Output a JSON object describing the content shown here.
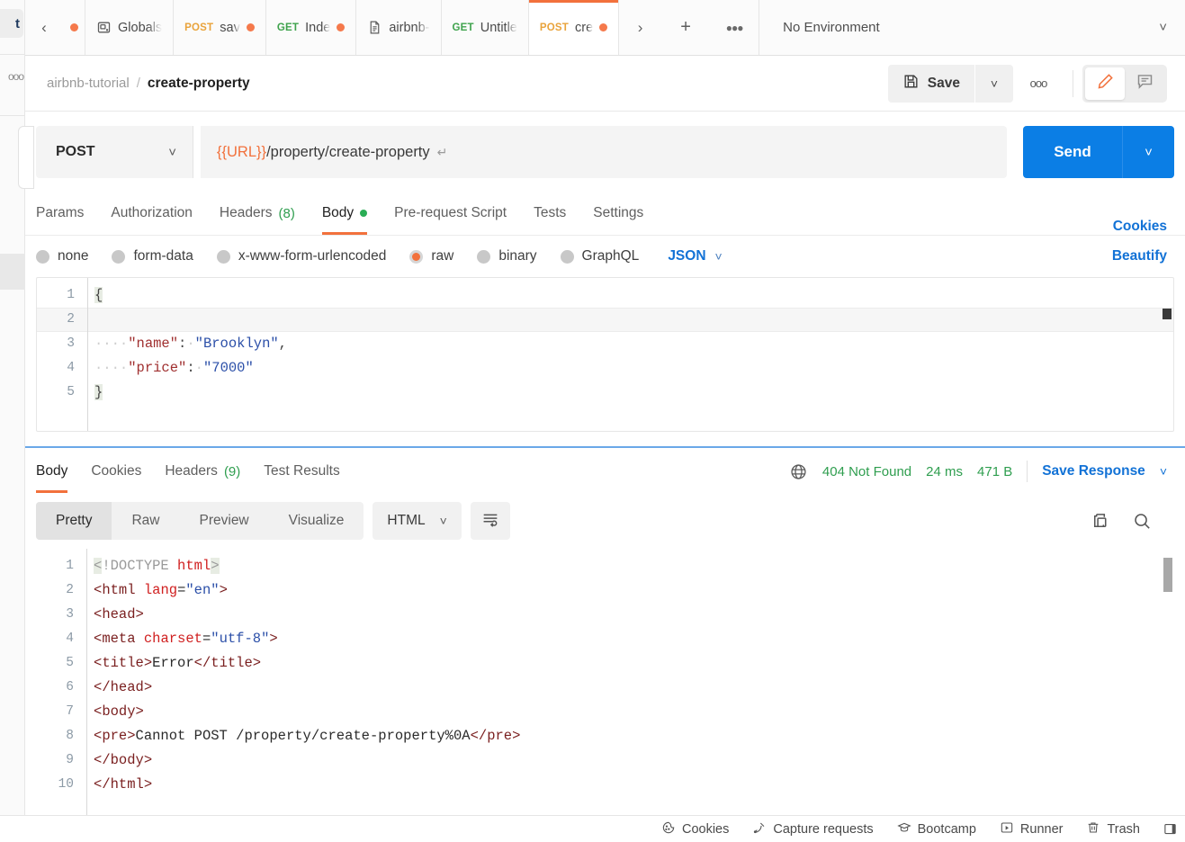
{
  "window": {
    "edge_sidebar": {
      "chip_text": "t",
      "dots": "ooo"
    }
  },
  "tabbar": {
    "back_icon": "chevron-left-icon",
    "lead_dot": "unsaved-dot",
    "tabs": [
      {
        "icon": "globals-icon",
        "method": "",
        "label": "Globals",
        "dirty": false
      },
      {
        "icon": "",
        "method": "POST",
        "label": "sav",
        "dirty": true
      },
      {
        "icon": "",
        "method": "GET",
        "label": "Inde",
        "dirty": true
      },
      {
        "icon": "doc-icon",
        "method": "",
        "label": "airbnb-",
        "dirty": false
      },
      {
        "icon": "",
        "method": "GET",
        "label": "Untitle",
        "dirty": false
      },
      {
        "icon": "",
        "method": "POST",
        "label": "cre",
        "dirty": true,
        "active": true
      }
    ],
    "forward_icon": "chevron-right-icon",
    "new_tab_icon": "plus-icon",
    "more_icon": "ellipsis-icon",
    "environment": "No Environment",
    "environment_chevron": "chevron-down-icon"
  },
  "breadcrumb": {
    "parent": "airbnb-tutorial",
    "separator": "/",
    "current": "create-property",
    "save_label": "Save",
    "save_icon": "floppy-disk-icon",
    "save_chevron": "chevron-down-icon",
    "more": "ooo",
    "edit_icon": "pencil-icon",
    "comment_icon": "comment-icon"
  },
  "request": {
    "method": "POST",
    "method_chevron": "chevron-down-icon",
    "url_variable": "{{URL}}",
    "url_path": "/property/create-property",
    "url_return_glyph": "↵",
    "send_label": "Send",
    "send_chevron": "chevron-down-icon",
    "tabs": [
      {
        "label": "Params",
        "count": "",
        "dot": false,
        "active": false
      },
      {
        "label": "Authorization",
        "count": "",
        "dot": false,
        "active": false
      },
      {
        "label": "Headers",
        "count": "(8)",
        "dot": false,
        "active": false
      },
      {
        "label": "Body",
        "count": "",
        "dot": true,
        "active": true
      },
      {
        "label": "Pre-request Script",
        "count": "",
        "dot": false,
        "active": false
      },
      {
        "label": "Tests",
        "count": "",
        "dot": false,
        "active": false
      },
      {
        "label": "Settings",
        "count": "",
        "dot": false,
        "active": false
      }
    ],
    "cookies_link": "Cookies",
    "body_types": [
      {
        "label": "none",
        "selected": false
      },
      {
        "label": "form-data",
        "selected": false
      },
      {
        "label": "x-www-form-urlencoded",
        "selected": false
      },
      {
        "label": "raw",
        "selected": true
      },
      {
        "label": "binary",
        "selected": false
      },
      {
        "label": "GraphQL",
        "selected": false
      }
    ],
    "raw_format": "JSON",
    "raw_format_chevron": "chevron-down-icon",
    "beautify_label": "Beautify",
    "body_lines": [
      {
        "n": "1",
        "open_brace": "{"
      },
      {
        "n": "2",
        "empty": true,
        "highlighted": true
      },
      {
        "n": "3",
        "indent": "····",
        "key": "\"name\"",
        "colon": ":",
        "space": "·",
        "value": "\"Brooklyn\"",
        "tail": ","
      },
      {
        "n": "4",
        "indent": "····",
        "key": "\"price\"",
        "colon": ":",
        "space": "·",
        "value": "\"7000\"",
        "tail": ""
      },
      {
        "n": "5",
        "close_brace": "}"
      }
    ]
  },
  "response": {
    "tabs": [
      {
        "label": "Body",
        "count": "",
        "active": true
      },
      {
        "label": "Cookies",
        "count": "",
        "active": false
      },
      {
        "label": "Headers",
        "count": "(9)",
        "active": false
      },
      {
        "label": "Test Results",
        "count": "",
        "active": false
      }
    ],
    "globe_icon": "globe-icon",
    "status": "404 Not Found",
    "time": "24 ms",
    "size": "471 B",
    "save_response_label": "Save Response",
    "save_response_chevron": "chevron-down-icon",
    "view_modes": [
      {
        "label": "Pretty",
        "active": true
      },
      {
        "label": "Raw",
        "active": false
      },
      {
        "label": "Preview",
        "active": false
      },
      {
        "label": "Visualize",
        "active": false
      }
    ],
    "format": "HTML",
    "format_chevron": "chevron-down-icon",
    "wrap_icon": "word-wrap-icon",
    "copy_icon": "copy-icon",
    "search_icon": "search-icon",
    "body_lines": [
      {
        "n": "1",
        "text": "<!DOCTYPE html>"
      },
      {
        "n": "2",
        "text": "<html lang=\"en\">"
      },
      {
        "n": "3",
        "text": "<head>"
      },
      {
        "n": "4",
        "text": "<meta charset=\"utf-8\">"
      },
      {
        "n": "5",
        "text": "<title>Error</title>"
      },
      {
        "n": "6",
        "text": "</head>"
      },
      {
        "n": "7",
        "text": "<body>"
      },
      {
        "n": "8",
        "text": "<pre>Cannot POST /property/create-property%0A</pre>"
      },
      {
        "n": "9",
        "text": "</body>"
      },
      {
        "n": "10",
        "text": "</html>"
      }
    ]
  },
  "statusbar": {
    "items": [
      {
        "icon": "cookie-icon",
        "label": "Cookies"
      },
      {
        "icon": "satellite-icon",
        "label": "Capture requests"
      },
      {
        "icon": "bootcamp-icon",
        "label": "Bootcamp"
      },
      {
        "icon": "runner-icon",
        "label": "Runner"
      },
      {
        "icon": "trash-icon",
        "label": "Trash"
      }
    ],
    "end_icon": "panel-toggle-icon"
  },
  "colors": {
    "accent_orange": "#f2713c",
    "send_blue": "#0b7ee5",
    "link_blue": "#1272d6",
    "status_green": "#2f9e4f",
    "method_post": "#e9a33b",
    "method_get": "#3fa34d"
  }
}
